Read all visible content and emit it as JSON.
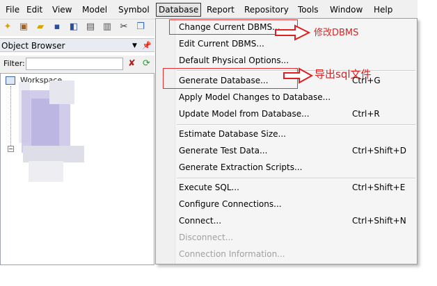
{
  "menubar": {
    "items": [
      {
        "label": "File"
      },
      {
        "label": "Edit"
      },
      {
        "label": "View"
      },
      {
        "label": "Model"
      },
      {
        "label": "Symbol"
      },
      {
        "label": "Database"
      },
      {
        "label": "Report"
      },
      {
        "label": "Repository"
      },
      {
        "label": "Tools"
      },
      {
        "label": "Window"
      },
      {
        "label": "Help"
      }
    ],
    "active": "Database"
  },
  "toolbar": {
    "icons": [
      "new-icon",
      "package-icon",
      "open-icon",
      "save-icon",
      "save-all-icon",
      "print-preview-icon",
      "print-icon",
      "cut-icon",
      "copy-icon"
    ]
  },
  "object_browser": {
    "title": "Object Browser",
    "filter_label": "Filter:",
    "filter_value": "",
    "workspace_label": "Workspace"
  },
  "database_menu": {
    "items": [
      {
        "label": "Change Current DBMS...",
        "shortcut": "",
        "enabled": true
      },
      {
        "label": "Edit Current DBMS...",
        "shortcut": "",
        "enabled": true
      },
      {
        "label": "Default Physical Options...",
        "shortcut": "",
        "enabled": true
      },
      {
        "label": "Generate Database...",
        "shortcut": "Ctrl+G",
        "enabled": true
      },
      {
        "label": "Apply Model Changes to Database...",
        "shortcut": "",
        "enabled": true
      },
      {
        "label": "Update Model from Database...",
        "shortcut": "Ctrl+R",
        "enabled": true
      },
      {
        "label": "Estimate Database Size...",
        "shortcut": "",
        "enabled": true
      },
      {
        "label": "Generate Test Data...",
        "shortcut": "Ctrl+Shift+D",
        "enabled": true
      },
      {
        "label": "Generate Extraction Scripts...",
        "shortcut": "",
        "enabled": true
      },
      {
        "label": "Execute SQL...",
        "shortcut": "Ctrl+Shift+E",
        "enabled": true
      },
      {
        "label": "Configure Connections...",
        "shortcut": "",
        "enabled": true
      },
      {
        "label": "Connect...",
        "shortcut": "Ctrl+Shift+N",
        "enabled": true
      },
      {
        "label": "Disconnect...",
        "shortcut": "",
        "enabled": false
      },
      {
        "label": "Connection Information...",
        "shortcut": "",
        "enabled": false
      }
    ]
  },
  "annotations": {
    "change_dbms_note": "修改DBMS",
    "generate_db_note": "导出sql文件",
    "color": "#e02020"
  }
}
